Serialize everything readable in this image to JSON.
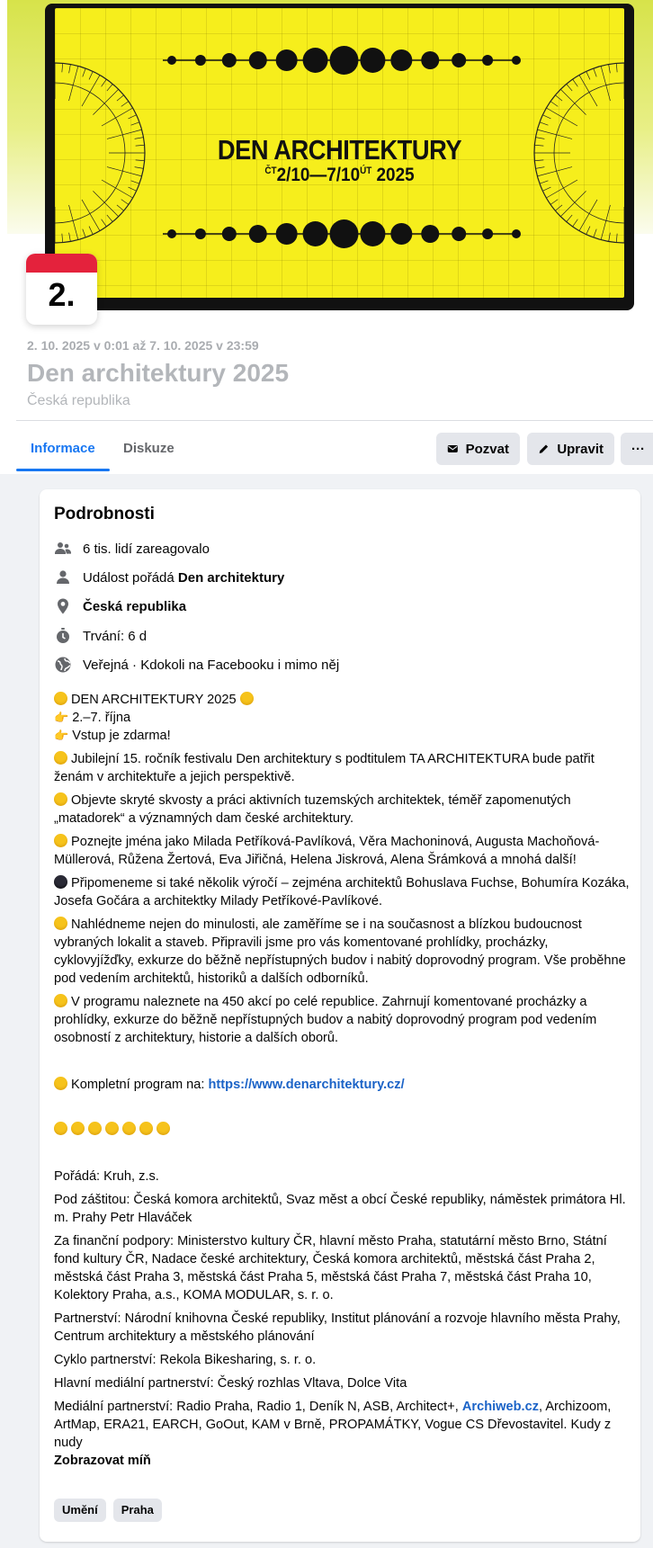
{
  "cover": {
    "title": "DEN ARCHITEKTURY",
    "date_pre": "ČT",
    "date_range": "2/10—7/10",
    "date_mid": "ÚT",
    "date_year": "2025"
  },
  "date_badge": {
    "day": "2."
  },
  "event": {
    "time": "2. 10. 2025 v 0:01 až 7. 10. 2025 v 23:59",
    "title": "Den architektury 2025",
    "location": "Česká republika"
  },
  "tabs": [
    {
      "label": "Informace"
    },
    {
      "label": "Diskuze"
    }
  ],
  "actions": {
    "invite": "Pozvat",
    "edit": "Upravit",
    "more": "···"
  },
  "details": {
    "title": "Podrobnosti",
    "reacted": "6 tis. lidí zareagovalo",
    "host_prefix": "Událost pořádá ",
    "host_name": "Den architektury",
    "place": "Česká republika",
    "duration": "Trvání: 6 d",
    "privacy": "Veřejná · Kdokoli na Facebooku i mimo něj"
  },
  "description": {
    "l1": "DEN ARCHITEKTURY 2025",
    "l2": "2.–7. října",
    "l3": "Vstup je zdarma!",
    "p1": "Jubilejní 15. ročník festivalu Den architektury s podtitulem TA ARCHITEKTURA bude patřit ženám v architektuře a jejich perspektivě.",
    "p2": "Objevte skryté skvosty a práci aktivních tuzemských architektek, téměř zapomenutých „matadorek“ a významných dam české architektury.",
    "p3": "Poznejte jména jako Milada Petříková-Pavlíková, Věra Machoninová, Augusta Machoňová-Müllerová, Růžena Žertová, Eva Jiřičná, Helena Jiskrová, Alena Šrámková a mnohá další!",
    "p4": "Připomeneme si také několik výročí – zejména architektů Bohuslava Fuchse, Bohumíra Kozáka, Josefa Gočára a architektky Milady Petříkové-Pavlíkové.",
    "p5": "Nahlédneme nejen do minulosti, ale zaměříme se i na současnost a blízkou budoucnost vybraných lokalit a staveb. Připravili jsme pro vás komentované prohlídky, procházky, cyklovyjížďky, exkurze do běžně nepřístupných budov i nabitý doprovodný program. Vše proběhne pod vedením architektů, historiků a dalších odborníků.",
    "p6": "V programu naleznete na 450 akcí po celé republice. Zahrnují komentované procházky a prohlídky, exkurze do běžně nepřístupných budov a nabitý doprovodný program pod vedením osobností z architektury, historie a dalších oborů.",
    "program_prefix": "Kompletní program na: ",
    "program_link": "https://www.denarchitektury.cz/",
    "organizer": "Pořádá: Kruh, z.s.",
    "patronage": "Pod záštitou: Česká komora architektů, Svaz měst a obcí České republiky, náměstek primátora Hl. m. Prahy Petr Hlaváček",
    "funding": "Za finanční podpory: Ministerstvo kultury ČR, hlavní město Praha, statutární město Brno, Státní fond kultury ČR, Nadace české architektury, Česká komora architektů, městská část Praha 2, městská část Praha 3, městská část Praha 5, městská část Praha 7, městská část Praha 10, Kolektory Praha, a.s., KOMA MODULAR, s. r. o.",
    "partnership": "Partnerství: Národní knihovna České republiky, Institut plánování a rozvoje hlavního města Prahy, Centrum architektury a městského plánování",
    "cycle": "Cyklo partnerství: Rekola Bikesharing, s. r. o.",
    "media_main": "Hlavní mediální partnerství: Český rozhlas Vltava, Dolce Vita",
    "media_prefix": "Mediální partnerství: Radio Praha, Radio 1, Deník N, ASB, Architect+, ",
    "media_link": "Archiweb.cz",
    "media_suffix": ", Archizoom, ArtMap, ERA21, EARCH, GoOut, KAM v Brně, PROPAMÁTKY, Vogue CS Dřevostavitel. Kudy z nudy",
    "show_less": "Zobrazovat míň"
  },
  "tags": [
    {
      "label": "Umění"
    },
    {
      "label": "Praha"
    }
  ]
}
